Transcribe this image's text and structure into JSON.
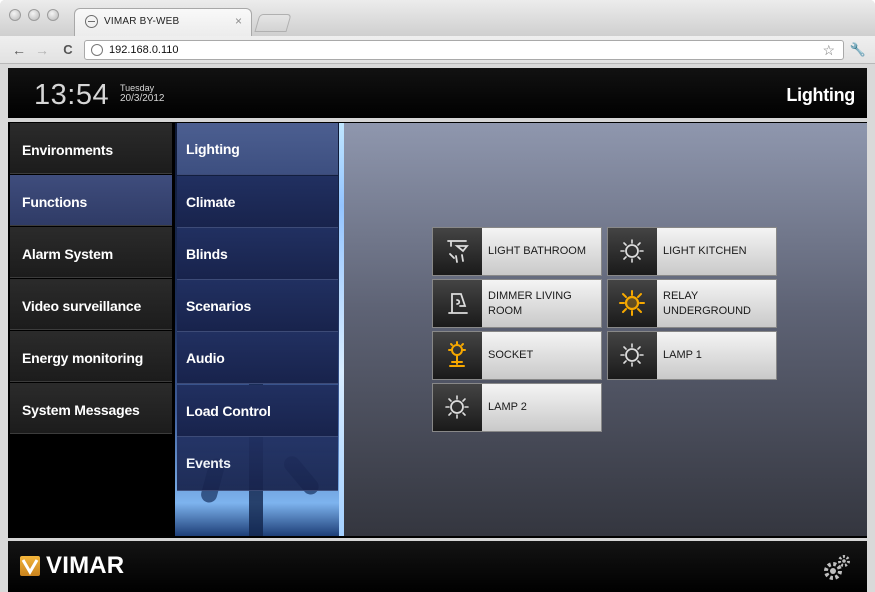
{
  "browser": {
    "tab_title": "VIMAR BY-WEB",
    "tab_close": "×",
    "url": "192.168.0.110",
    "back": "←",
    "forward": "→",
    "reload": "C",
    "bookmark": "☆",
    "settings": "🔧"
  },
  "header": {
    "time": "13:54",
    "day": "Tuesday",
    "date": "20/3/2012",
    "page_title": "Lighting"
  },
  "sidebar": {
    "items": [
      {
        "label": "Environments"
      },
      {
        "label": "Functions"
      },
      {
        "label": "Alarm System"
      },
      {
        "label": "Video surveillance"
      },
      {
        "label": "Energy monitoring"
      },
      {
        "label": "System Messages"
      }
    ],
    "active": "Functions"
  },
  "submenu": {
    "items": [
      {
        "label": "Lighting"
      },
      {
        "label": "Climate"
      },
      {
        "label": "Blinds"
      },
      {
        "label": "Scenarios"
      },
      {
        "label": "Audio"
      },
      {
        "label": "Load Control"
      },
      {
        "label": "Events"
      }
    ],
    "active": "Lighting"
  },
  "devices": [
    {
      "label": "LIGHT BATHROOM",
      "icon": "spotlight-icon",
      "state": "off"
    },
    {
      "label": "LIGHT KITCHEN",
      "icon": "bulb-icon",
      "state": "off"
    },
    {
      "label": "DIMMER LIVING ROOM",
      "icon": "dimmer-icon",
      "state": "off"
    },
    {
      "label": "RELAY UNDERGROUND",
      "icon": "bulb-icon",
      "state": "on"
    },
    {
      "label": "SOCKET",
      "icon": "socket-icon",
      "state": "on"
    },
    {
      "label": "LAMP 1",
      "icon": "bulb-icon",
      "state": "off"
    },
    {
      "label": "LAMP 2",
      "icon": "bulb-icon",
      "state": "off"
    }
  ],
  "footer": {
    "logo_text": "VIMAR",
    "settings_icon": "gear-icon"
  },
  "colors": {
    "active_on": "#f6a800",
    "icon_off": "#dddddd",
    "active_menu": "#3f4d7d"
  }
}
